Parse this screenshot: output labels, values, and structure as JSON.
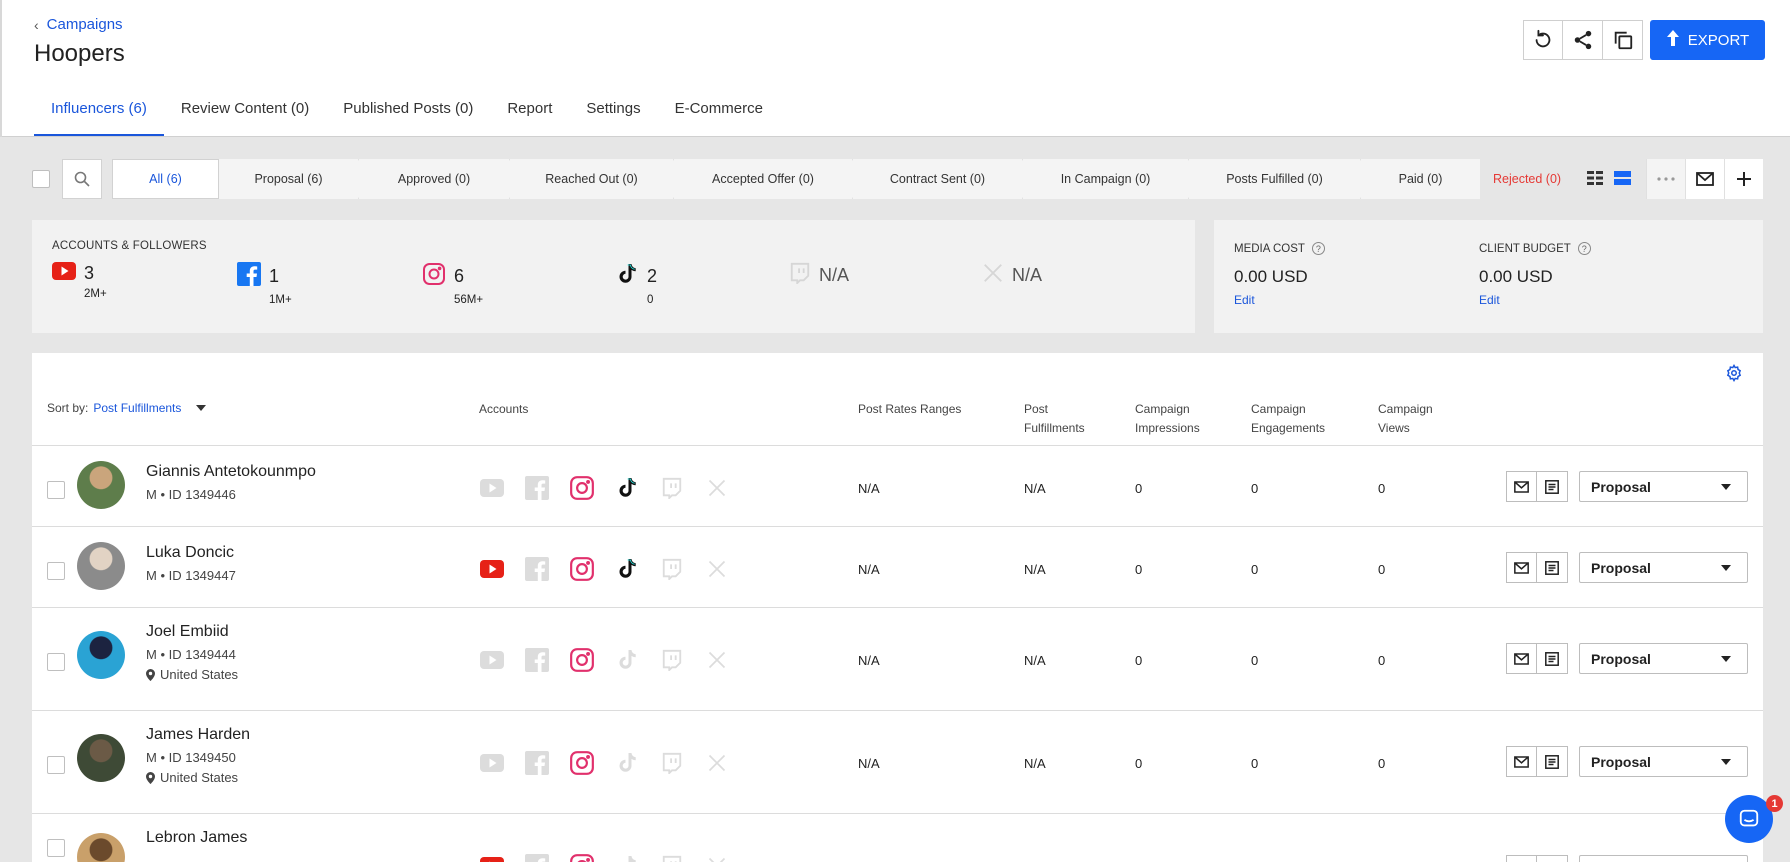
{
  "header": {
    "breadcrumb": "Campaigns",
    "title": "Hoopers",
    "export_label": "EXPORT"
  },
  "tabs": [
    {
      "label": "Influencers (6)",
      "active": true
    },
    {
      "label": "Review Content (0)"
    },
    {
      "label": "Published Posts (0)"
    },
    {
      "label": "Report"
    },
    {
      "label": "Settings"
    },
    {
      "label": "E-Commerce"
    }
  ],
  "stages": [
    {
      "label": "All (6)",
      "active": true
    },
    {
      "label": "Proposal (6)"
    },
    {
      "label": "Approved (0)"
    },
    {
      "label": "Reached Out (0)"
    },
    {
      "label": "Accepted Offer (0)"
    },
    {
      "label": "Contract Sent (0)"
    },
    {
      "label": "In Campaign (0)"
    },
    {
      "label": "Posts Fulfilled (0)"
    },
    {
      "label": "Paid (0)"
    }
  ],
  "rejected_label": "Rejected (0)",
  "accounts": {
    "heading": "ACCOUNTS & FOLLOWERS",
    "items": [
      {
        "icon": "youtube-icon",
        "count": "3",
        "followers": "2M+"
      },
      {
        "icon": "facebook-icon",
        "count": "1",
        "followers": "1M+"
      },
      {
        "icon": "instagram-icon",
        "count": "6",
        "followers": "56M+"
      },
      {
        "icon": "tiktok-icon",
        "count": "2",
        "followers": "0"
      },
      {
        "icon": "twitch-icon",
        "count": "N/A",
        "followers": ""
      },
      {
        "icon": "x-icon",
        "count": "N/A",
        "followers": ""
      }
    ]
  },
  "budget": {
    "media_cost_label": "MEDIA COST",
    "media_cost_value": "0.00 USD",
    "client_budget_label": "CLIENT BUDGET",
    "client_budget_value": "0.00 USD",
    "edit_label": "Edit"
  },
  "table": {
    "sort_label": "Sort by:",
    "sort_value": "Post Fulfillments",
    "columns": {
      "accounts": "Accounts",
      "rates": "Post Rates Ranges",
      "fulfillments_1": "Post",
      "fulfillments_2": "Fulfillments",
      "impressions_1": "Campaign",
      "impressions_2": "Impressions",
      "engagements_1": "Campaign",
      "engagements_2": "Engagements",
      "views_1": "Campaign",
      "views_2": "Views"
    },
    "rows": [
      {
        "name": "Giannis Antetokounmpo",
        "meta": "M • ID 1349446",
        "location": "",
        "rates": "N/A",
        "fulfillments": "N/A",
        "impressions": "0",
        "engagements": "0",
        "views": "0",
        "status": "Proposal",
        "accounts": {
          "youtube": false,
          "facebook": false,
          "instagram": true,
          "tiktok": true,
          "twitch": false,
          "x": false
        }
      },
      {
        "name": "Luka Doncic",
        "meta": "M • ID 1349447",
        "location": "",
        "rates": "N/A",
        "fulfillments": "N/A",
        "impressions": "0",
        "engagements": "0",
        "views": "0",
        "status": "Proposal",
        "accounts": {
          "youtube": true,
          "facebook": false,
          "instagram": true,
          "tiktok": true,
          "twitch": false,
          "x": false
        }
      },
      {
        "name": "Joel Embiid",
        "meta": "M • ID 1349444",
        "location": "United States",
        "rates": "N/A",
        "fulfillments": "N/A",
        "impressions": "0",
        "engagements": "0",
        "views": "0",
        "status": "Proposal",
        "accounts": {
          "youtube": false,
          "facebook": false,
          "instagram": true,
          "tiktok": false,
          "twitch": false,
          "x": false
        }
      },
      {
        "name": "James Harden",
        "meta": "M • ID 1349450",
        "location": "United States",
        "rates": "N/A",
        "fulfillments": "N/A",
        "impressions": "0",
        "engagements": "0",
        "views": "0",
        "status": "Proposal",
        "accounts": {
          "youtube": false,
          "facebook": false,
          "instagram": true,
          "tiktok": false,
          "twitch": false,
          "x": false
        }
      },
      {
        "name": "Lebron James",
        "meta": "",
        "location": "",
        "rates": "",
        "fulfillments": "",
        "impressions": "",
        "engagements": "",
        "views": "",
        "status": "",
        "accounts": {
          "youtube": true,
          "facebook": false,
          "instagram": true,
          "tiktok": false,
          "twitch": false,
          "x": false
        }
      }
    ]
  },
  "chat": {
    "badge": "1"
  },
  "colors": {
    "accent": "#1666f5",
    "link": "#1a56db",
    "rejected": "#e53935",
    "youtube": "#e62117",
    "facebook": "#1877f2",
    "instagram": "#e1306c",
    "inactive": "#dcdcdc"
  }
}
